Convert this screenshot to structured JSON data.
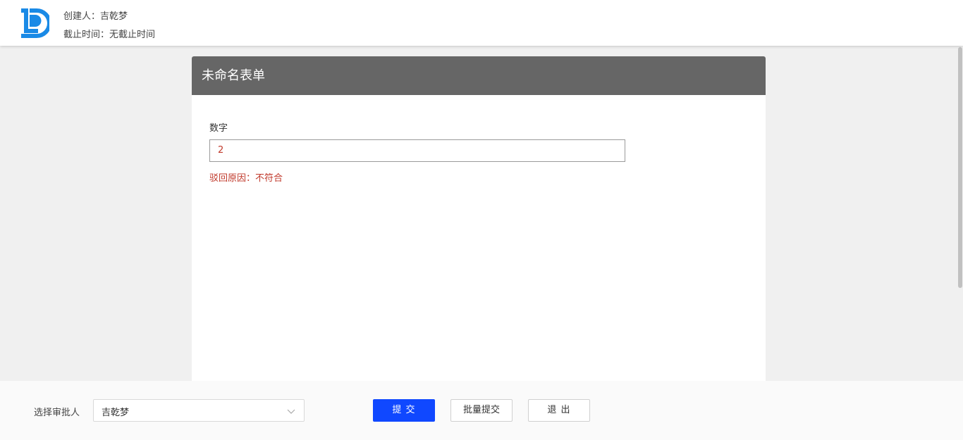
{
  "header": {
    "creator_text": "创建人：吉乾梦",
    "deadline_text": "截止时间：无截止时间",
    "logo_icon": "ld-logo-icon",
    "logo_color": "#1a8ae6"
  },
  "form": {
    "title": "未命名表单",
    "title_bar_color": "#666666",
    "fields": [
      {
        "label": "数字",
        "value": "2",
        "reject_reason": "驳回原因：不符合"
      }
    ]
  },
  "footer": {
    "approver_label": "选择审批人",
    "approver_value": "吉乾梦",
    "approver_chevron_icon": "chevron-down-icon",
    "submit_label": "提 交",
    "batch_submit_label": "批量提交",
    "exit_label": "退 出",
    "primary_color": "#1048ff"
  },
  "colors": {
    "error_text": "#c0392b",
    "page_background": "#f0f0f0"
  }
}
